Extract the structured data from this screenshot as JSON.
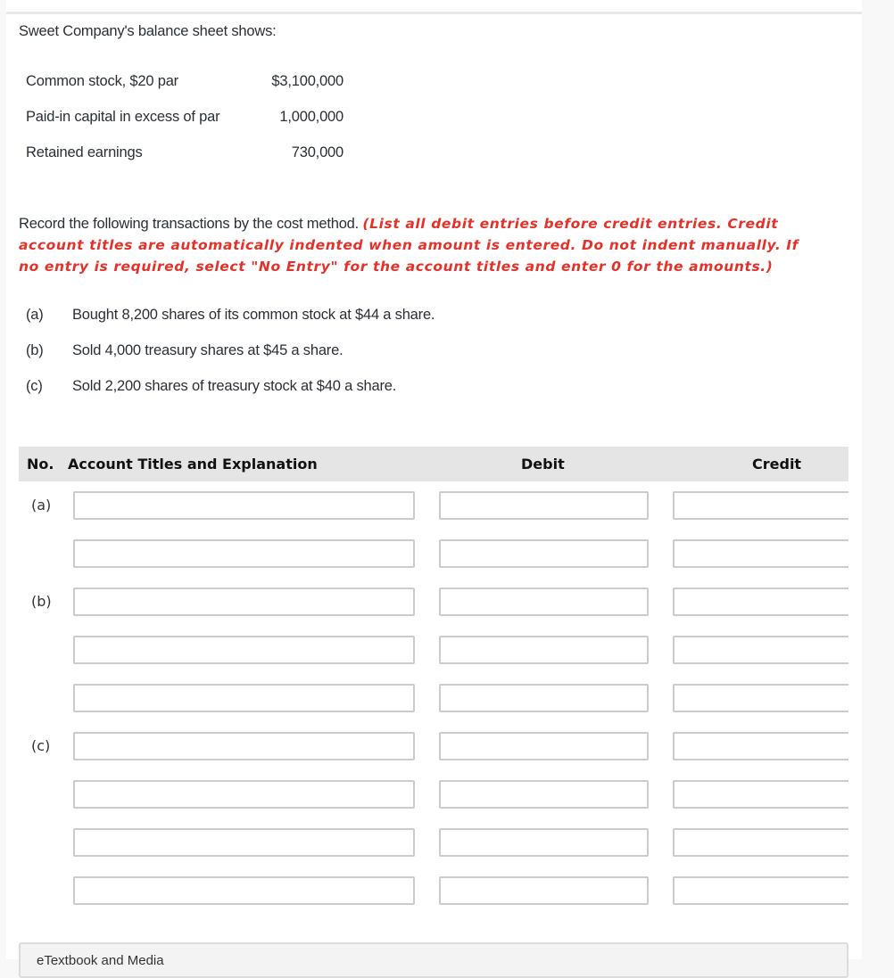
{
  "problem": {
    "intro": "Sweet Company's balance sheet shows:",
    "balance_sheet": [
      {
        "label": "Common stock, $20 par",
        "value": "$3,100,000"
      },
      {
        "label": "Paid-in capital in excess of par",
        "value": "1,000,000"
      },
      {
        "label": "Retained earnings",
        "value": "730,000"
      }
    ],
    "instruction": "Record the following transactions by the cost method.",
    "instruction_note": "(List all debit entries before credit entries. Credit account titles are automatically indented when amount is entered. Do not indent manually. If no entry is required, select \"No Entry\" for the account titles and enter 0 for the amounts.)",
    "transactions": [
      {
        "key": "(a)",
        "text": "Bought 8,200 shares of its common stock at $44 a share."
      },
      {
        "key": "(b)",
        "text": "Sold 4,000 treasury shares at $45 a share."
      },
      {
        "key": "(c)",
        "text": "Sold 2,200 shares of treasury stock at $40 a share."
      }
    ]
  },
  "journal": {
    "headers": {
      "no": "No.",
      "account": "Account Titles and Explanation",
      "debit": "Debit",
      "credit": "Credit"
    },
    "rows": [
      {
        "no": "(a)",
        "account": "",
        "debit": "",
        "credit": ""
      },
      {
        "no": "",
        "account": "",
        "debit": "",
        "credit": ""
      },
      {
        "no": "(b)",
        "account": "",
        "debit": "",
        "credit": ""
      },
      {
        "no": "",
        "account": "",
        "debit": "",
        "credit": ""
      },
      {
        "no": "",
        "account": "",
        "debit": "",
        "credit": ""
      },
      {
        "no": "(c)",
        "account": "",
        "debit": "",
        "credit": ""
      },
      {
        "no": "",
        "account": "",
        "debit": "",
        "credit": ""
      },
      {
        "no": "",
        "account": "",
        "debit": "",
        "credit": ""
      },
      {
        "no": "",
        "account": "",
        "debit": "",
        "credit": ""
      }
    ]
  },
  "resources": {
    "label": "eTextbook and Media"
  }
}
